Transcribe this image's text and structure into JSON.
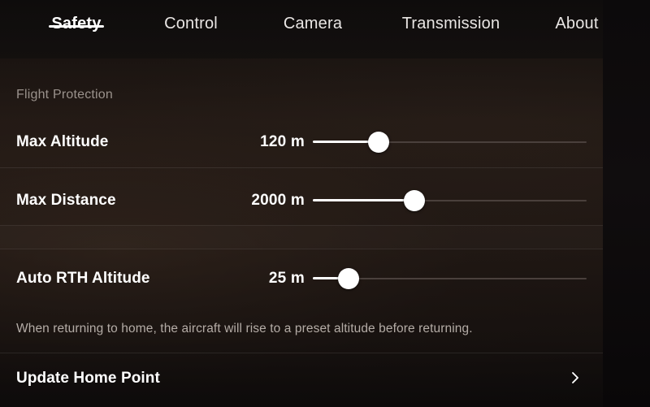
{
  "tabs": [
    {
      "label": "Safety",
      "active": true
    },
    {
      "label": "Control",
      "active": false
    },
    {
      "label": "Camera",
      "active": false
    },
    {
      "label": "Transmission",
      "active": false
    },
    {
      "label": "About",
      "active": false
    }
  ],
  "section": {
    "title": "Flight Protection"
  },
  "settings": [
    {
      "label": "Max Altitude",
      "value": "120 m",
      "number": 120,
      "unit": "m",
      "slider_percent": 24
    },
    {
      "label": "Max Distance",
      "value": "2000 m",
      "number": 2000,
      "unit": "m",
      "slider_percent": 37
    },
    {
      "label": "Auto RTH Altitude",
      "value": "25 m",
      "number": 25,
      "unit": "m",
      "slider_percent": 13
    }
  ],
  "note": "When returning to home, the aircraft will rise to a preset altitude before returning.",
  "update_home_point": {
    "label": "Update Home Point",
    "chevron_icon": "chevron-right-icon"
  },
  "colors": {
    "accent": "#ffffff",
    "panel_bg": "#1d1511",
    "muted_text": "#9a928c",
    "note_text": "#b4aca6",
    "track_inactive": "#4a403c"
  }
}
